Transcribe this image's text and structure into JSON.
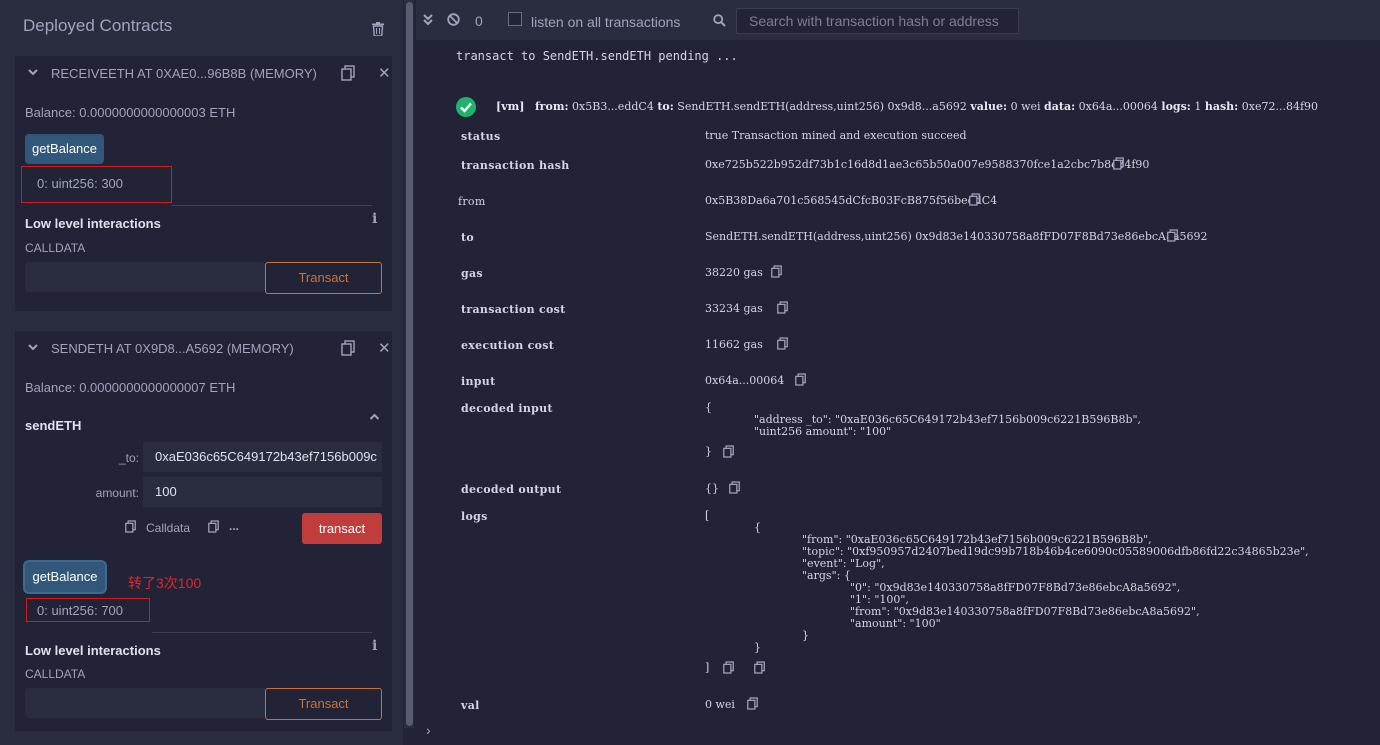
{
  "left": {
    "title": "Deployed Contracts",
    "contract1": {
      "name": "RECEIVEETH AT 0XAE0...96B8B (MEMORY)",
      "balance": "Balance: 0.0000000000000003 ETH",
      "get_balance_label": "getBalance",
      "output": "0: uint256: 300",
      "low_level_label": "Low level interactions",
      "calldata_label": "CALLDATA",
      "transact_label": "Transact"
    },
    "contract2": {
      "name": "SENDETH AT 0X9D8...A5692 (MEMORY)",
      "balance": "Balance: 0.0000000000000007 ETH",
      "function_name": "sendETH",
      "param_to_label": "_to:",
      "param_to_value": "0xaE036c65C649172b43ef7156b009c",
      "param_amount_label": "amount:",
      "param_amount_value": "100",
      "calldata_link": "Calldata",
      "more_link": "...",
      "transact_label": "transact",
      "get_balance_label": "getBalance",
      "annotation": "转了3次100",
      "output": "0: uint256: 700",
      "low_level_label": "Low level interactions",
      "calldata_label": "CALLDATA",
      "transact_outline_label": "Transact"
    }
  },
  "terminal": {
    "tx_count": "0",
    "listen_label": "listen on all transactions",
    "search_placeholder": "Search with transaction hash or address",
    "pending_line": "transact to SendETH.sendETH pending ...",
    "summary": {
      "vm": "[vm]",
      "from_k": "from:",
      "from_v": "0x5B3...eddC4",
      "to_k": "to:",
      "to_v": "SendETH.sendETH(address,uint256) 0x9d8...a5692",
      "value_k": "value:",
      "value_v": "0 wei",
      "data_k": "data:",
      "data_v": "0x64a...00064",
      "logs_k": "logs:",
      "logs_v": "1",
      "hash_k": "hash:",
      "hash_v": "0xe72...84f90"
    },
    "rows": {
      "status_k": "status",
      "status_v": "true Transaction mined and execution succeed",
      "hash_k": "transaction hash",
      "hash_v": "0xe725b522b952df73b1c16d8d1ae3c65b50a007e9588370fce1a2cbc7b8c84f90",
      "from_k": "from",
      "from_v": "0x5B38Da6a701c568545dCfcB03FcB875f56beddC4",
      "to_k": "to",
      "to_v": "SendETH.sendETH(address,uint256) 0x9d83e140330758a8fFD07F8Bd73e86ebcA8a5692",
      "gas_k": "gas",
      "gas_v": "38220 gas",
      "tcost_k": "transaction cost",
      "tcost_v": "33234 gas",
      "ecost_k": "execution cost",
      "ecost_v": "11662 gas",
      "input_k": "input",
      "input_v": "0x64a...00064",
      "dinput_k": "decoded input",
      "dinput_open": "{",
      "dinput_body": "\"address _to\": \"0xaE036c65C649172b43ef7156b009c6221B596B8b\",\n\"uint256 amount\": \"100\"",
      "dinput_close": "}",
      "doutput_k": "decoded output",
      "doutput_v": "{}",
      "logs_k": "logs",
      "logs_open": "[",
      "logs_obj_open": "{",
      "logs_body": "\"from\": \"0xaE036c65C649172b43ef7156b009c6221B596B8b\",\n\"topic\": \"0xf950957d2407bed19dc99b718b46b4ce6090c05589006dfb86fd22c34865b23e\",\n\"event\": \"Log\",\n\"args\": {",
      "args_body": "\"0\": \"0x9d83e140330758a8fFD07F8Bd73e86ebcA8a5692\",\n\"1\": \"100\",\n\"from\": \"0x9d83e140330758a8fFD07F8Bd73e86ebcA8a5692\",\n\"amount\": \"100\"",
      "logs_obj_close": "}",
      "logs_close": "]",
      "val_k": "val",
      "val_v": "0 wei"
    },
    "prompt": "›"
  },
  "colors": {
    "accent_orange": "#c97539",
    "transact_red": "#c13d3d",
    "button_blue": "#31587a",
    "success_green": "#21b26e",
    "annotation_red": "#e0262c"
  }
}
